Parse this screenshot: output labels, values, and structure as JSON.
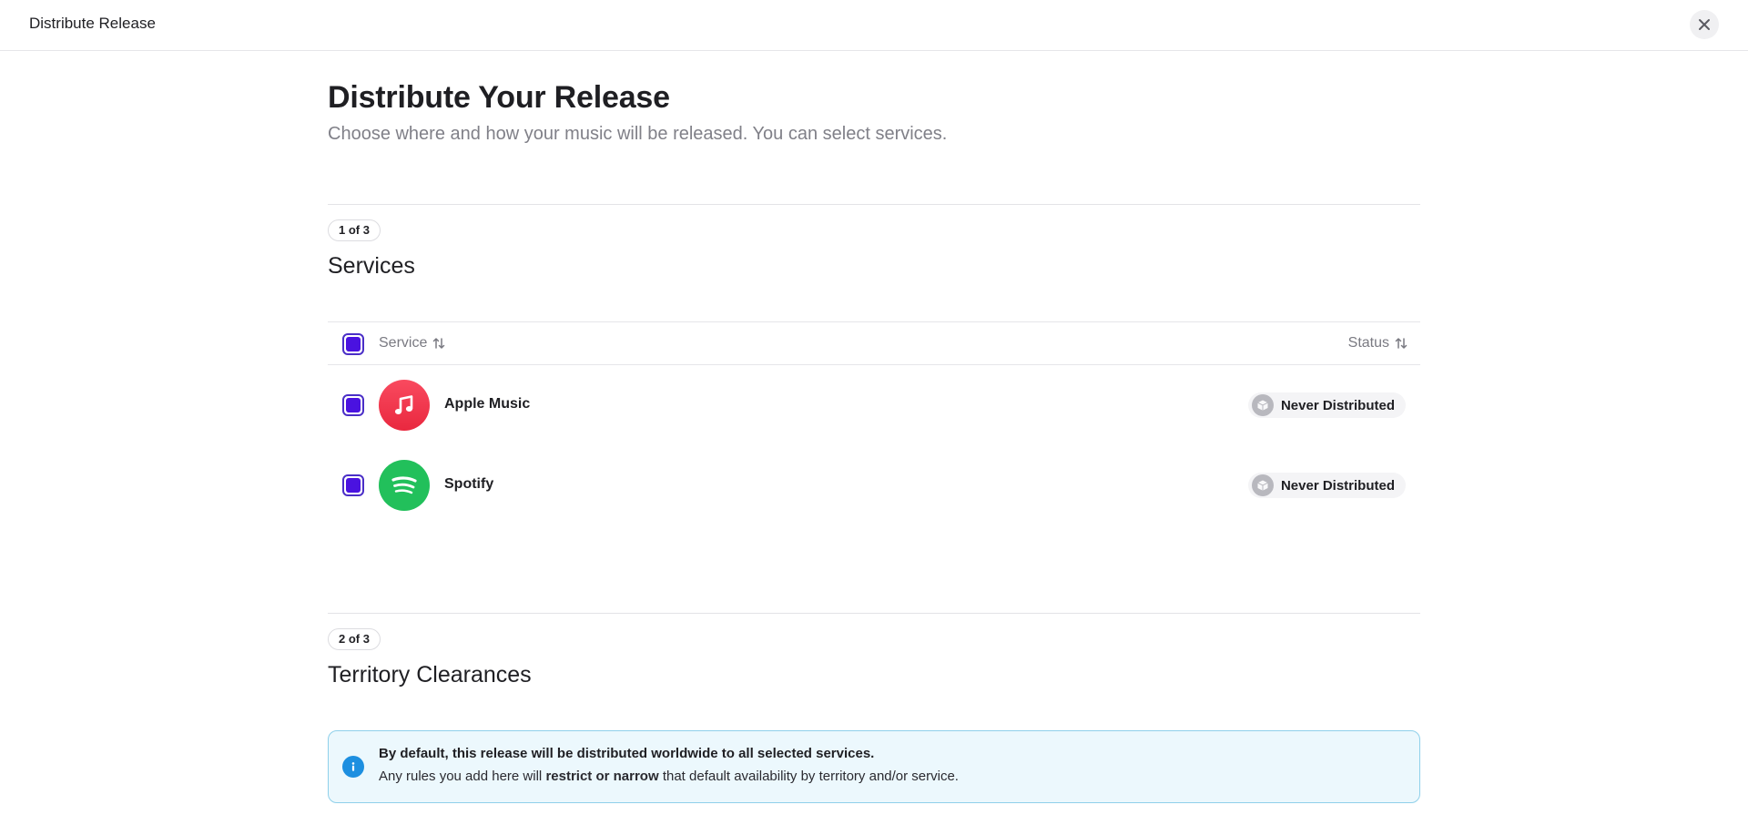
{
  "window": {
    "title": "Distribute Release"
  },
  "page": {
    "title": "Distribute Your Release",
    "subtitle": "Choose where and how your music will be released. You can select services."
  },
  "services_section": {
    "step": "1 of 3",
    "title": "Services",
    "columns": {
      "service": "Service",
      "status": "Status"
    },
    "rows": [
      {
        "name": "Apple Music",
        "status": "Never Distributed",
        "selected": true,
        "icon": "apple-music-icon",
        "color": "#f0344c"
      },
      {
        "name": "Spotify",
        "status": "Never Distributed",
        "selected": true,
        "icon": "spotify-icon",
        "color": "#22c05b"
      }
    ],
    "select_all": true
  },
  "territory_section": {
    "step": "2 of 3",
    "title": "Territory Clearances",
    "info": {
      "line1": "By default, this release will be distributed worldwide to all selected services.",
      "line2_prefix": "Any rules you add here will ",
      "line2_bold": "restrict or narrow",
      "line2_suffix": " that default availability by territory and/or service."
    }
  },
  "colors": {
    "accent": "#4a12e0",
    "info_bg": "#ecf8fd",
    "info_border": "#8fd0ea",
    "info_icon": "#1d8fe0"
  }
}
